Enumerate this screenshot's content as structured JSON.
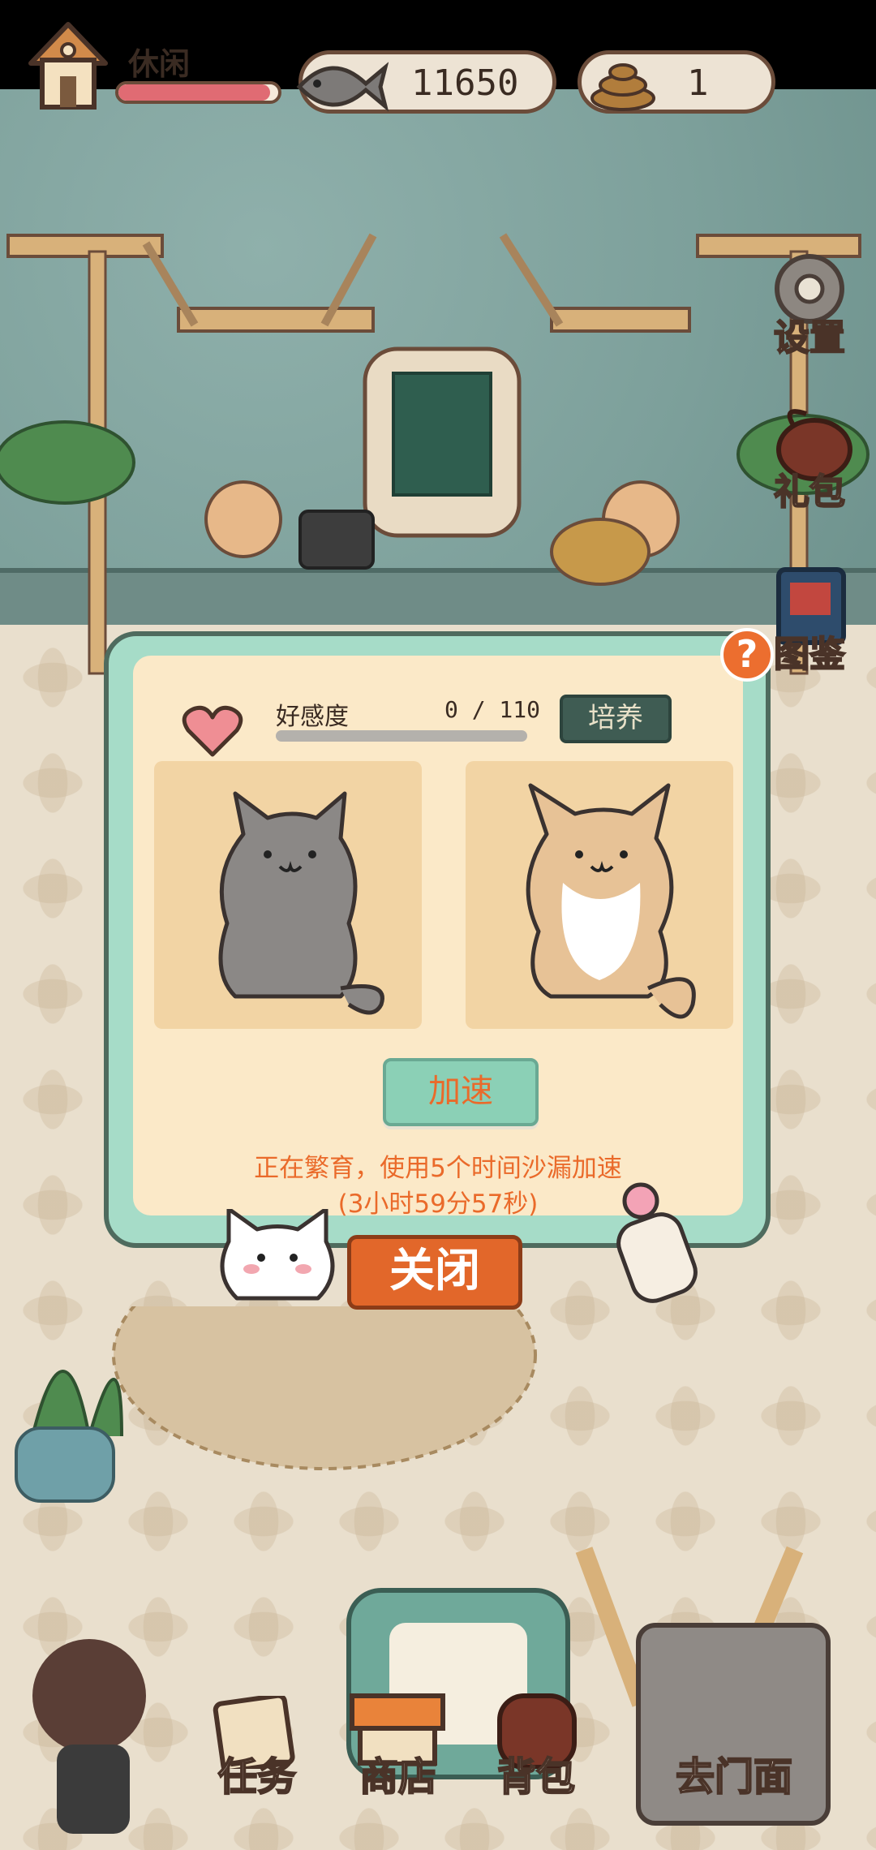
{
  "status": {
    "mood_label": "休闲",
    "mood_level": 0.95,
    "fish_value": "11650",
    "poop_value": "1"
  },
  "side_menu": [
    {
      "label": "设置",
      "icon": "gear-icon"
    },
    {
      "label": "礼包",
      "icon": "gift-bag-icon"
    },
    {
      "label": "图鉴",
      "icon": "book-icon"
    }
  ],
  "dialog": {
    "help_label": "?",
    "affinity_label": "好感度",
    "affinity_count": "0 / 110",
    "affinity_level": 0,
    "train_label": "培养",
    "speedup_label": "加速",
    "breed_info_line1": "正在繁育，使用5个时间沙漏加速",
    "breed_info_line2": "(3小时59分57秒)"
  },
  "close_label": "关闭",
  "bottom_nav": [
    {
      "label": "任务",
      "icon": "task-icon"
    },
    {
      "label": "商店",
      "icon": "shop-icon"
    },
    {
      "label": "背包",
      "icon": "backpack-icon"
    },
    {
      "label": "去门面",
      "icon": "storefront-icon"
    }
  ],
  "colors": {
    "accent": "#ea6a2a",
    "dialog_border": "#a6dcc8",
    "panel": "#fbe9c8",
    "heart": "#e06b73"
  }
}
